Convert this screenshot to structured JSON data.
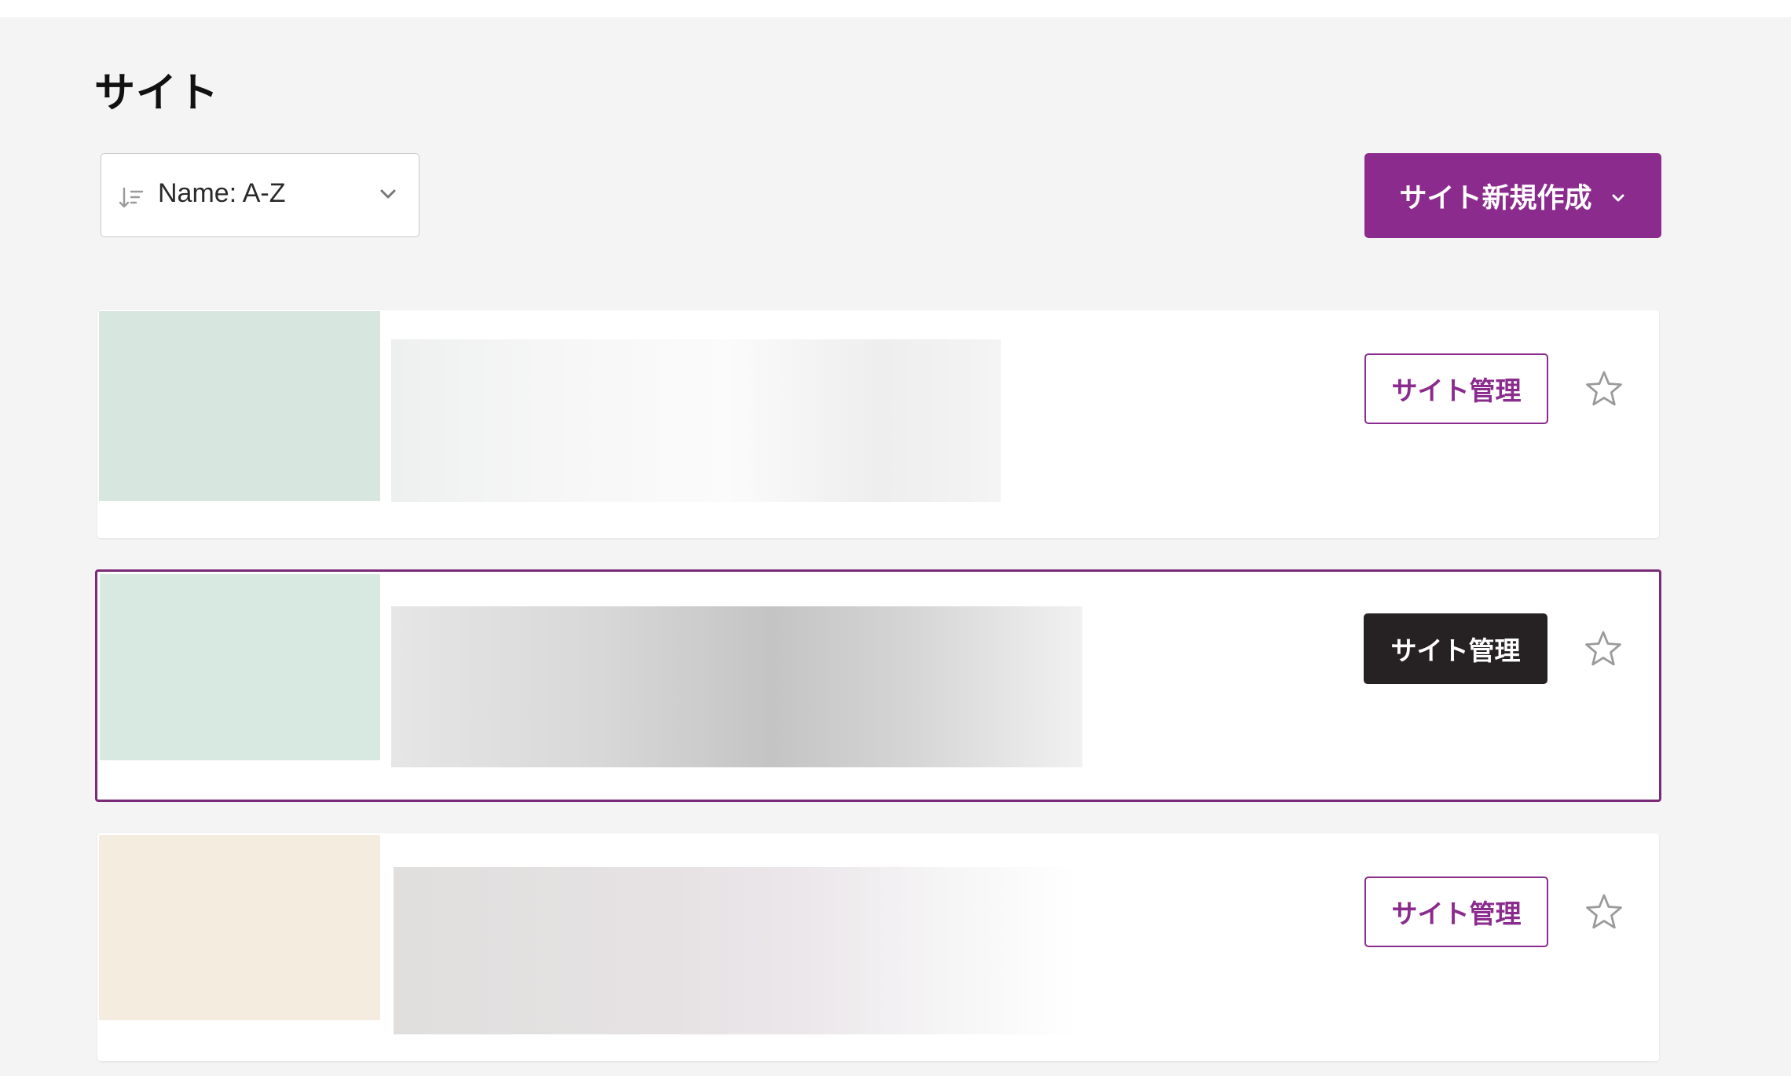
{
  "page": {
    "title": "サイト"
  },
  "toolbar": {
    "sort": {
      "icon": "sort-icon",
      "selected_label": "Name: A-Z",
      "chevron": "chevron-down-icon"
    },
    "new_site_button": {
      "label": "サイト新規作成",
      "icon": "chevron-down-icon"
    }
  },
  "sites": [
    {
      "manage_label": "サイト管理",
      "favorite_icon": "star-outline-icon",
      "selected": false
    },
    {
      "manage_label": "サイト管理",
      "favorite_icon": "star-outline-icon",
      "selected": true
    },
    {
      "manage_label": "サイト管理",
      "favorite_icon": "star-outline-icon",
      "selected": false
    }
  ],
  "colors": {
    "brand": "#8b2b8d",
    "selected_border": "#7a2a78",
    "dark_button": "#262224",
    "background": "#f4f4f4",
    "star": "#9a9a9a"
  }
}
